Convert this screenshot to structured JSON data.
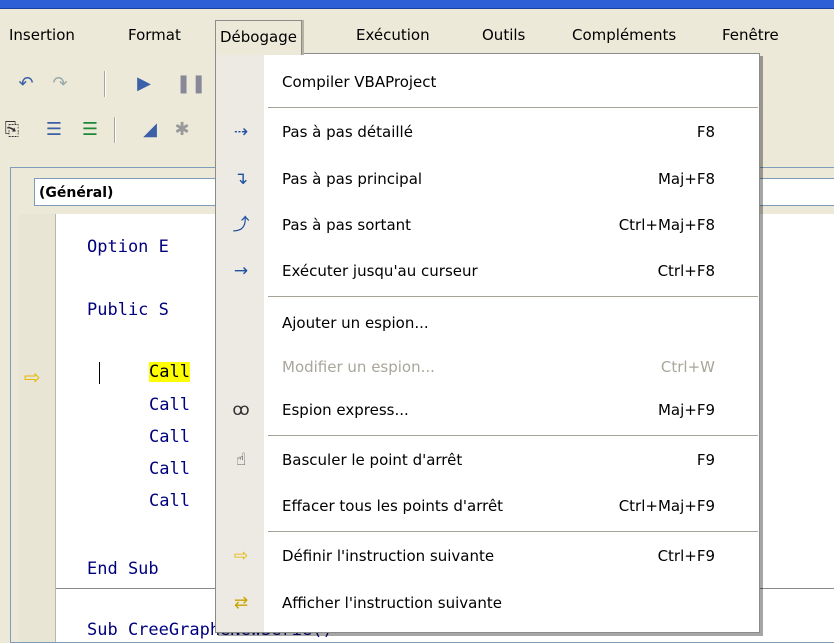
{
  "menubar": {
    "items": [
      {
        "label": "Insertion"
      },
      {
        "label": "Format"
      },
      {
        "label": "Débogage"
      },
      {
        "label": "Exécution"
      },
      {
        "label": "Outils"
      },
      {
        "label": "Compléments"
      },
      {
        "label": "Fenêtre"
      }
    ]
  },
  "code_window": {
    "procedure_combo": "(Général)",
    "lines": [
      {
        "text": "Option E"
      },
      {
        "text": "Public S"
      },
      {
        "text": "Call"
      },
      {
        "text": "Call"
      },
      {
        "text": "Call"
      },
      {
        "text": "Call"
      },
      {
        "text": "Call"
      },
      {
        "text": "End Sub"
      },
      {
        "text": "Sub CreeGrapheNewSerie()"
      }
    ]
  },
  "debug_menu": {
    "items": [
      {
        "label": "Compiler VBAProject",
        "shortcut": "",
        "icon": "",
        "enabled": true
      },
      {
        "label": "Pas à pas détaillé",
        "shortcut": "F8",
        "icon": "step-into-icon",
        "enabled": true
      },
      {
        "label": "Pas à pas principal",
        "shortcut": "Maj+F8",
        "icon": "step-over-icon",
        "enabled": true
      },
      {
        "label": "Pas à pas sortant",
        "shortcut": "Ctrl+Maj+F8",
        "icon": "step-out-icon",
        "enabled": true
      },
      {
        "label": "Exécuter jusqu'au curseur",
        "shortcut": "Ctrl+F8",
        "icon": "run-to-cursor-icon",
        "enabled": true
      },
      {
        "label": "Ajouter un espion...",
        "shortcut": "",
        "icon": "",
        "enabled": true
      },
      {
        "label": "Modifier un espion...",
        "shortcut": "Ctrl+W",
        "icon": "",
        "enabled": false
      },
      {
        "label": "Espion express...",
        "shortcut": "Maj+F9",
        "icon": "glasses-icon",
        "enabled": true
      },
      {
        "label": "Basculer le point d'arrêt",
        "shortcut": "F9",
        "icon": "hand-icon",
        "enabled": true
      },
      {
        "label": "Effacer tous les points d'arrêt",
        "shortcut": "Ctrl+Maj+F9",
        "icon": "",
        "enabled": true
      },
      {
        "label": "Définir l'instruction suivante",
        "shortcut": "Ctrl+F9",
        "icon": "next-statement-arrow-icon",
        "enabled": true
      },
      {
        "label": "Afficher l'instruction suivante",
        "shortcut": "",
        "icon": "show-next-statement-icon",
        "enabled": true
      }
    ]
  },
  "colors": {
    "highlight": "#ffff00",
    "code_keyword": "#00007f",
    "menu_bg": "#ece9d8"
  }
}
